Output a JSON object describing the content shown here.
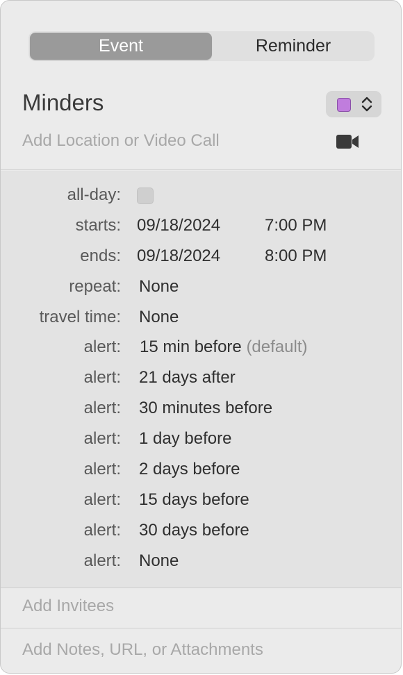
{
  "segmented": {
    "event_label": "Event",
    "reminder_label": "Reminder",
    "selected": "Event"
  },
  "event": {
    "title": "Minders",
    "calendar_color": "#c07ddd",
    "location_placeholder": "Add Location or Video Call"
  },
  "fields": {
    "all_day_label": "all-day:",
    "all_day_checked": false,
    "starts_label": "starts:",
    "starts_date": "09/18/2024",
    "starts_time": "7:00 PM",
    "ends_label": "ends:",
    "ends_date": "09/18/2024",
    "ends_time": "8:00 PM",
    "repeat_label": "repeat:",
    "repeat_value": "None",
    "travel_label": "travel time:",
    "travel_value": "None"
  },
  "alerts": {
    "label": "alert:",
    "default_note": "(default)",
    "items": [
      "15 min before",
      "21 days after",
      "30 minutes before",
      "1 day before",
      "2 days before",
      "15 days before",
      "30 days before",
      "None"
    ]
  },
  "footer": {
    "invitees_placeholder": "Add Invitees",
    "notes_placeholder": "Add Notes, URL, or Attachments"
  }
}
